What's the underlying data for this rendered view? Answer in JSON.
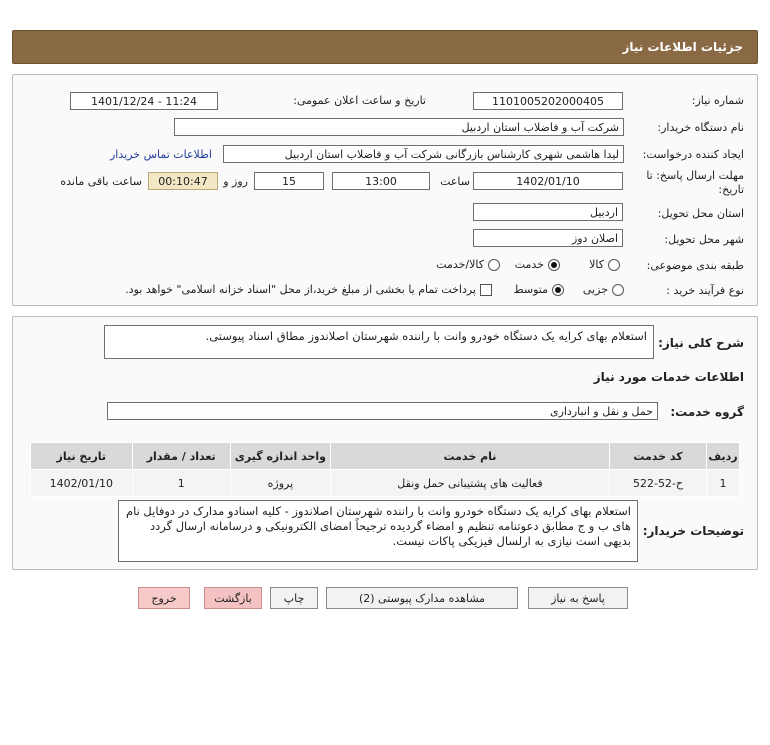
{
  "header": {
    "title": "جزئیات اطلاعات نیاز"
  },
  "form": {
    "need_number_label": "شماره نیاز:",
    "need_number": "1101005202000405",
    "announce_label": "تاریخ و ساعت اعلان عمومی:",
    "announce_value": "1401/12/24 - 11:24",
    "buyer_org_label": "نام دستگاه خریدار:",
    "buyer_org": "شرکت آب و فاضلاب استان اردبیل",
    "requester_label": "ایجاد کننده درخواست:",
    "requester": "لیدا  هاشمی شهری کارشناس بازرگانی شرکت آب و فاضلاب استان اردبیل",
    "contact_link": "اطلاعات تماس خریدار",
    "deadline_label_1": "مهلت ارسال پاسخ: تا",
    "deadline_label_2": "تاریخ:",
    "deadline_date": "1402/01/10",
    "time_label": "ساعت",
    "deadline_time": "13:00",
    "days_value": "15",
    "days_label": "روز و",
    "remaining_time": "00:10:47",
    "remaining_label": "ساعت باقی مانده",
    "province_label": "استان محل تحویل:",
    "province": "اردبیل",
    "city_label": "شهر محل تحویل:",
    "city": "اصلان دوز",
    "category_label": "طبقه بندی موضوعی:",
    "category_options": [
      "کالا",
      "خدمت",
      "کالا/خدمت"
    ],
    "process_label": "نوع فرآیند خرید :",
    "process_options": [
      "جزیی",
      "متوسط"
    ],
    "payment_note": "پرداخت تمام یا بخشی از مبلغ خرید،از محل \"اسناد خزانه اسلامی\" خواهد بود."
  },
  "summary": {
    "label": "شرح کلی نیاز:",
    "text": "استعلام بهای کرایه یک دستگاه خودرو وانت با راننده شهرستان اصلاندوز مطاق اسناد پیوستی."
  },
  "services": {
    "section_title": "اطلاعات خدمات مورد نیاز",
    "group_label": "گروه خدمت:",
    "group_value": "حمل و نقل و انبارداری",
    "columns": [
      "ردیف",
      "کد خدمت",
      "نام خدمت",
      "واحد اندازه گیری",
      "تعداد / مقدار",
      "تاریخ نیاز"
    ],
    "rows": [
      [
        "1",
        "ح-52-522",
        "فعالیت های پشتیبانی حمل ونقل",
        "پروژه",
        "1",
        "1402/01/10"
      ]
    ]
  },
  "buyer_notes": {
    "label": "توضیحات خریدار:",
    "text": "استعلام بهای کرایه یک دستگاه خودرو وانت با راننده شهرستان اصلاندوز - کلیه اسنادو مدارک در دوفایل نام های ب و ج مطابق دعوتنامه تنظیم و امضاء گردیده ترجیحاً امضای الکترونیکی و درسامانه ارسال گردد بدیهی است نیازی به ارلسال فیزیکی پاکات نیست."
  },
  "buttons": {
    "reply": "پاسخ به نیاز",
    "attachments": "مشاهده مدارک پیوستی (2)",
    "print": "چاپ",
    "back": "بازگشت",
    "exit": "خروج"
  }
}
